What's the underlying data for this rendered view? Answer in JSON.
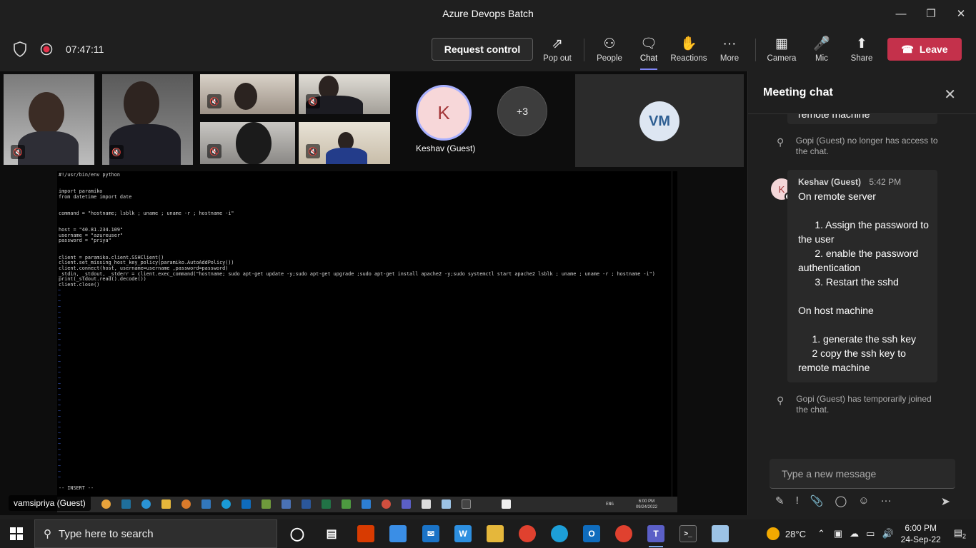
{
  "window": {
    "title": "Azure Devops Batch"
  },
  "toolbar": {
    "timer": "07:47:11",
    "request_control": "Request control",
    "buttons": {
      "popout": "Pop out",
      "people": "People",
      "chat": "Chat",
      "reactions": "Reactions",
      "more": "More",
      "camera": "Camera",
      "mic": "Mic",
      "share": "Share"
    },
    "leave": "Leave"
  },
  "participants": {
    "keshav_initial": "K",
    "keshav_name": "Keshav (Guest)",
    "overflow": "+3",
    "vm_initials": "VM",
    "presenter_name": "vamsipriya (Guest)"
  },
  "shared_screen": {
    "code_lines": [
      "#!/usr/bin/env python",
      "",
      "",
      "import paramiko",
      "from datetime import date",
      "",
      "",
      "command = \"hostname; lsblk ; uname ; uname -r ; hostname -i\"",
      "",
      "",
      "host = \"40.81.234.109\"",
      "username = \"azureuser\"",
      "password = \"priya\"",
      "",
      "",
      "client = paramiko.client.SSHClient()",
      "client.set_missing_host_key_policy(paramiko.AutoAddPolicy())",
      "client.connect(host, username=username ,password=password)",
      "_stdin, _stdout, _stderr = client.exec_command(\"hostname; sudo apt-get update -y;sudo apt-get upgrade ;sudo apt-get install apache2 -y;sudo systemctl start apache2 lsblk ; uname ; uname -r ; hostname -i\")",
      "print(_stdout.read().decode())",
      "client.close()"
    ],
    "mode": "-- INSERT --",
    "inner_time": "6:00 PM",
    "inner_date": "09/24/2022",
    "inner_lang": "ENG"
  },
  "chat": {
    "title": "Meeting chat",
    "partial_text": "remote machine",
    "sys1": "Gopi (Guest) no longer has access to the chat.",
    "msg": {
      "avatar": "K",
      "author": "Keshav (Guest)",
      "time": "5:42 PM",
      "body": "On remote server\n\n      1. Assign the password to the user\n      2. enable the password authentication\n      3. Restart the sshd\n\nOn host machine\n\n     1. generate the ssh key\n     2 copy the ssh key to remote machine"
    },
    "sys2": "Gopi (Guest) has temporarily joined the chat.",
    "compose_placeholder": "Type a new message"
  },
  "taskbar": {
    "search_placeholder": "Type here to search",
    "weather": "28°C",
    "time": "6:00 PM",
    "date": "24-Sep-22",
    "notifications": "2"
  }
}
